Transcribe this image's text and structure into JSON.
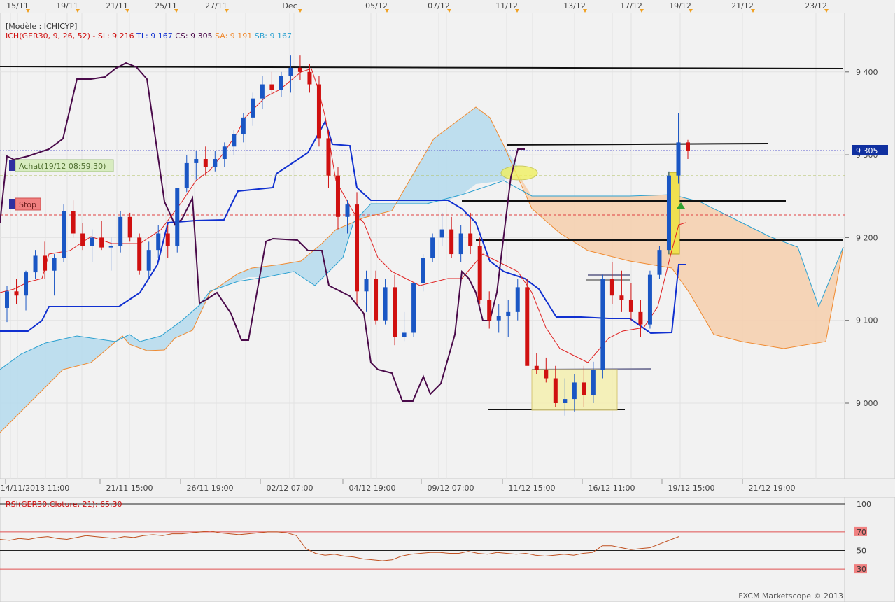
{
  "header": {
    "model": "[Modèle : ICHICYP]",
    "ich_label": "ICH(GER30, 9, 26, 52) -",
    "sl": "SL: 9 216",
    "tl": "TL: 9 167",
    "cs": "CS: 9 305",
    "sa": "SA: 9 191",
    "sb": "SB: 9 167"
  },
  "labels": {
    "achat": "Achat(19/12 08:59,30)",
    "stop": "Stop",
    "price_badge": "9 305"
  },
  "top_dates": [
    "15/11",
    "19/11",
    "21/11",
    "25/11",
    "27/11",
    "Dec",
    "05/12",
    "07/12",
    "11/12",
    "13/12",
    "17/12",
    "19/12",
    "21/12",
    "23/12"
  ],
  "bottom_dates": [
    "14/11/2013 11:00",
    "21/11 15:00",
    "26/11 19:00",
    "02/12 07:00",
    "04/12 19:00",
    "09/12 07:00",
    "11/12 15:00",
    "16/12 11:00",
    "19/12 15:00",
    "21/12 19:00"
  ],
  "rsi": {
    "label": "RSI(GER30.Cloture, 21): 65,30",
    "levels": [
      "100",
      "70",
      "50",
      "30"
    ]
  },
  "footer": "FXCM Marketscope © 2013",
  "colors": {
    "bull": "#1a56c4",
    "bear": "#d01010",
    "tenkan": "#e02020",
    "kijun": "#1030d0",
    "chikou": "#4a0a4a",
    "cloud_bull": "#b8dced",
    "cloud_bear": "#f5d0b0",
    "senkou_a": "#f08a30",
    "senkou_b": "#2aa0d0"
  },
  "chart_data": {
    "type": "candlestick",
    "instrument": "GER30",
    "ylim": [
      8880,
      9440
    ],
    "yticks": [
      9000,
      9100,
      9200,
      9300,
      9400
    ],
    "current_price": 9305,
    "ichimoku": {
      "tenkan_sen": 9216,
      "kijun_sen": 9167,
      "chikou_span": 9305,
      "senkou_a": 9191,
      "senkou_b": 9167
    },
    "series": [
      {
        "name": "Candles (estimated)",
        "values": [
          [
            9115,
            9142,
            9098,
            9135
          ],
          [
            9135,
            9150,
            9120,
            9130
          ],
          [
            9130,
            9160,
            9112,
            9158
          ],
          [
            9158,
            9185,
            9150,
            9178
          ],
          [
            9178,
            9195,
            9150,
            9160
          ],
          [
            9160,
            9180,
            9130,
            9175
          ],
          [
            9175,
            9240,
            9170,
            9232
          ],
          [
            9232,
            9245,
            9200,
            9205
          ],
          [
            9205,
            9218,
            9185,
            9190
          ],
          [
            9190,
            9210,
            9170,
            9200
          ],
          [
            9200,
            9220,
            9185,
            9188
          ],
          [
            9188,
            9200,
            9160,
            9190
          ],
          [
            9190,
            9232,
            9182,
            9225
          ],
          [
            9225,
            9230,
            9195,
            9200
          ],
          [
            9200,
            9205,
            9155,
            9160
          ],
          [
            9160,
            9195,
            9150,
            9185
          ],
          [
            9185,
            9215,
            9175,
            9205
          ],
          [
            9205,
            9215,
            9175,
            9190
          ],
          [
            9190,
            9250,
            9182,
            9260
          ],
          [
            9260,
            9300,
            9255,
            9290
          ],
          [
            9290,
            9305,
            9270,
            9295
          ],
          [
            9295,
            9310,
            9275,
            9285
          ],
          [
            9285,
            9305,
            9280,
            9295
          ],
          [
            9295,
            9315,
            9285,
            9310
          ],
          [
            9310,
            9330,
            9300,
            9325
          ],
          [
            9325,
            9350,
            9315,
            9345
          ],
          [
            9345,
            9375,
            9335,
            9368
          ],
          [
            9368,
            9395,
            9355,
            9385
          ],
          [
            9385,
            9400,
            9372,
            9378
          ],
          [
            9378,
            9400,
            9370,
            9395
          ],
          [
            9395,
            9420,
            9375,
            9405
          ],
          [
            9405,
            9420,
            9390,
            9400
          ],
          [
            9400,
            9410,
            9375,
            9385
          ],
          [
            9385,
            9395,
            9310,
            9320
          ],
          [
            9320,
            9330,
            9260,
            9275
          ],
          [
            9275,
            9285,
            9210,
            9225
          ],
          [
            9225,
            9245,
            9205,
            9240
          ],
          [
            9240,
            9255,
            9120,
            9135
          ],
          [
            9135,
            9160,
            9110,
            9150
          ],
          [
            9150,
            9160,
            9095,
            9100
          ],
          [
            9100,
            9150,
            9095,
            9140
          ],
          [
            9140,
            9155,
            9070,
            9080
          ],
          [
            9080,
            9110,
            9075,
            9085
          ],
          [
            9085,
            9145,
            9080,
            9145
          ],
          [
            9145,
            9180,
            9135,
            9175
          ],
          [
            9175,
            9205,
            9170,
            9200
          ],
          [
            9200,
            9230,
            9190,
            9210
          ],
          [
            9210,
            9225,
            9175,
            9180
          ],
          [
            9180,
            9215,
            9170,
            9205
          ],
          [
            9205,
            9230,
            9180,
            9190
          ],
          [
            9190,
            9200,
            9120,
            9125
          ],
          [
            9125,
            9135,
            9090,
            9100
          ],
          [
            9100,
            9120,
            9085,
            9105
          ],
          [
            9105,
            9125,
            9080,
            9110
          ],
          [
            9110,
            9150,
            9100,
            9140
          ],
          [
            9140,
            9150,
            9050,
            9045
          ],
          [
            9045,
            9060,
            9035,
            9040
          ],
          [
            9040,
            9055,
            9025,
            9030
          ],
          [
            9030,
            9045,
            8995,
            9000
          ],
          [
            9000,
            9030,
            8985,
            9005
          ],
          [
            9005,
            9035,
            8990,
            9025
          ],
          [
            9025,
            9045,
            8995,
            9010
          ],
          [
            9010,
            9050,
            9000,
            9040
          ],
          [
            9040,
            9155,
            9030,
            9150
          ],
          [
            9150,
            9170,
            9120,
            9130
          ],
          [
            9130,
            9160,
            9110,
            9125
          ],
          [
            9125,
            9145,
            9100,
            9110
          ],
          [
            9110,
            9125,
            9080,
            9095
          ],
          [
            9095,
            9160,
            9090,
            9155
          ],
          [
            9155,
            9190,
            9150,
            9185
          ],
          [
            9185,
            9280,
            9180,
            9275
          ],
          [
            9275,
            9350,
            9265,
            9315
          ],
          [
            9315,
            9318,
            9295,
            9305
          ]
        ]
      }
    ]
  }
}
